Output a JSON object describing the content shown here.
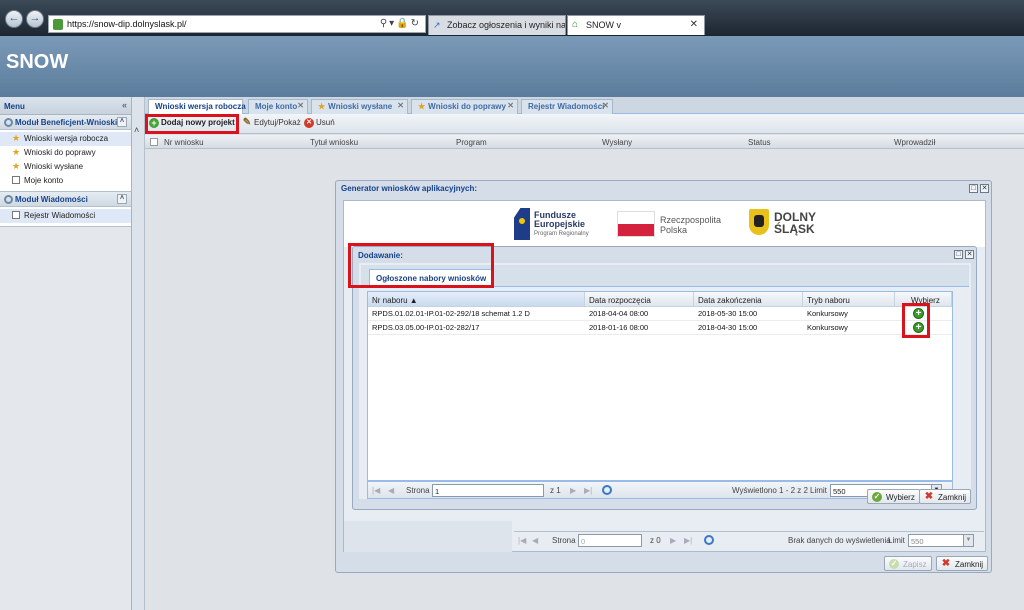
{
  "browser": {
    "url": "https://snow-dip.dolnyslask.pl/",
    "tabs": [
      {
        "label": "Zobacz ogłoszenia i wyniki nab..."
      },
      {
        "label": "SNOW v"
      }
    ]
  },
  "app": {
    "title": "SNOW"
  },
  "sidebar": {
    "menu_label": "Menu",
    "sections": [
      {
        "title": "Moduł Beneficjent-Wnioski",
        "items": [
          {
            "label": "Wnioski wersja robocza"
          },
          {
            "label": "Wnioski do poprawy"
          },
          {
            "label": "Wnioski wysłane"
          },
          {
            "label": "Moje konto"
          }
        ]
      },
      {
        "title": "Moduł Wiadomości",
        "items": [
          {
            "label": "Rejestr Wiadomości"
          }
        ]
      }
    ]
  },
  "main": {
    "tabs": [
      {
        "label": "Wnioski wersja robocza"
      },
      {
        "label": "Moje konto"
      },
      {
        "label": "Wnioski wysłane"
      },
      {
        "label": "Wnioski do poprawy"
      },
      {
        "label": "Rejestr Wiadomości"
      }
    ],
    "toolbar": {
      "add_label": "Dodaj nowy projekt",
      "edit_label": "Edytuj/Pokaż",
      "delete_label": "Usuń"
    },
    "columns": [
      "Nr wniosku",
      "Tytuł wniosku",
      "Program",
      "Wysłany",
      "Status",
      "Wprowadził"
    ]
  },
  "generator": {
    "title": "Generator wniosków aplikacyjnych:",
    "logos": {
      "fe": {
        "line1": "Fundusze",
        "line2": "Europejskie",
        "sub": "Program Regionalny"
      },
      "rp": {
        "line1": "Rzeczpospolita",
        "line2": "Polska"
      },
      "ds": {
        "line1": "DOLNY",
        "line2": "ŚLĄSK"
      }
    },
    "pager": {
      "page_label": "Strona",
      "page_value": "0",
      "of_label": "z 0",
      "status": "Brak danych do wyświetlenia",
      "limit_label": "Limit",
      "limit_value": "550"
    },
    "save_label": "Zapisz",
    "close_label": "Zamknij"
  },
  "dialog": {
    "title": "Dodawanie:",
    "tab_label": "Ogłoszone nabory wniosków",
    "columns": [
      "Nr naboru",
      "Data rozpoczęcia",
      "Data zakończenia",
      "Tryb naboru",
      "Wybierz"
    ],
    "rows": [
      {
        "nr": "RPDS.01.02.01-IP.01-02-292/18 schemat 1.2 D",
        "start": "2018-04-04 08:00",
        "end": "2018-05-30 15:00",
        "mode": "Konkursowy"
      },
      {
        "nr": "RPDS.03.05.00-IP.01-02-282/17",
        "start": "2018-01-16 08:00",
        "end": "2018-04-30 15:00",
        "mode": "Konkursowy"
      }
    ],
    "pager": {
      "page_label": "Strona",
      "page_value": "1",
      "of_label": "z 1",
      "status": "Wyświetlono 1 - 2 z 2",
      "limit_label": "Limit",
      "limit_value": "550"
    },
    "select_label": "Wybierz",
    "close_label": "Zamknij"
  },
  "colors": {
    "highlight": "#d9121c",
    "header": "#6a8aaa",
    "accent": "#15428b"
  }
}
